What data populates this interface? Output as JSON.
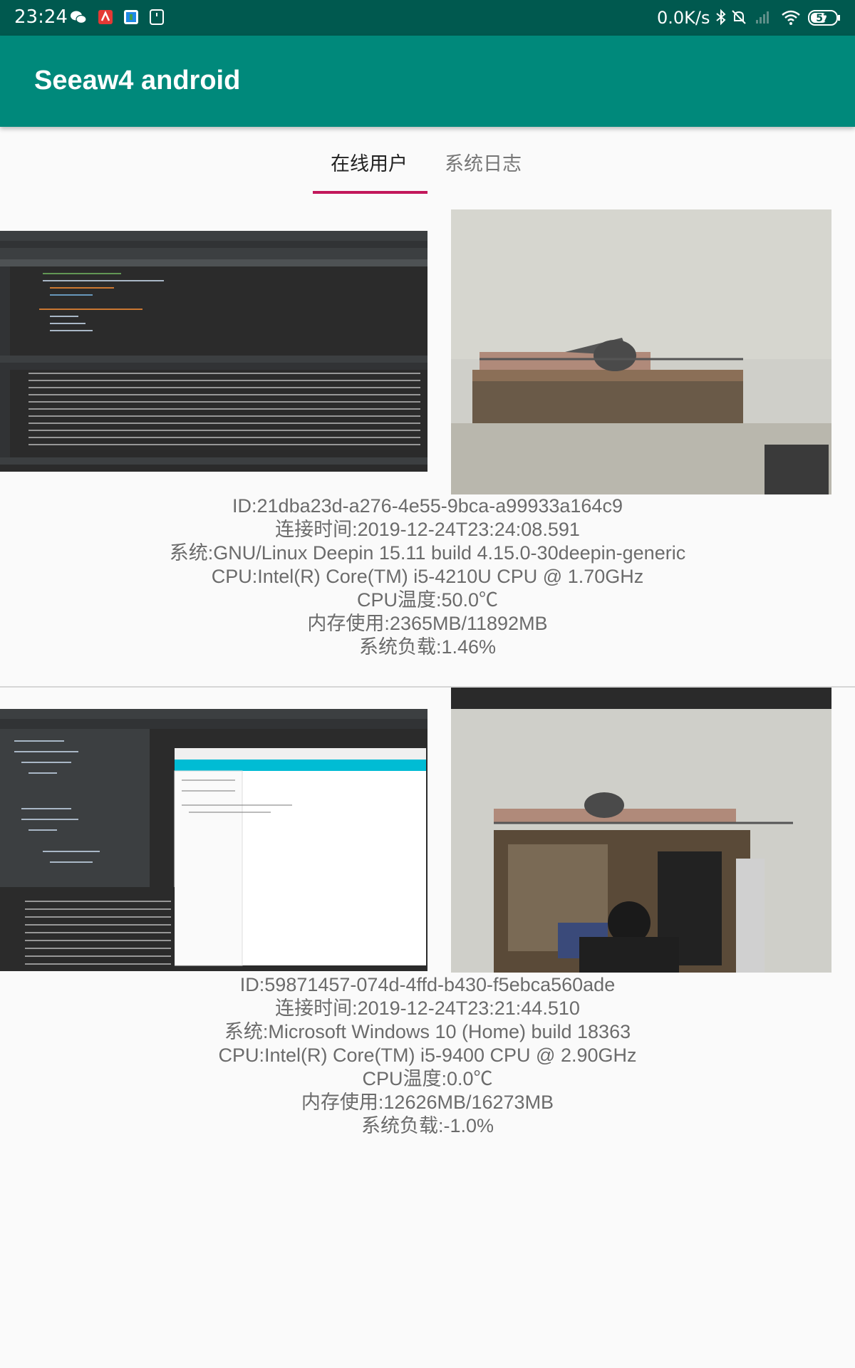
{
  "status_bar": {
    "time": "23:24",
    "network_speed": "0.0K/s",
    "battery": "57"
  },
  "app_bar": {
    "title": "Seeaw4 android"
  },
  "tabs": [
    {
      "label": "在线用户",
      "selected": true
    },
    {
      "label": "系统日志",
      "selected": false
    }
  ],
  "accent_color": "#c2185b",
  "toolbar_color": "#00897b",
  "users": [
    {
      "id": "ID:21dba23d-a276-4e55-9bca-a99933a164c9",
      "connect_time": "连接时间:2019-12-24T23:24:08.591",
      "os": "系统:GNU/Linux Deepin 15.11 build 4.15.0-30deepin-generic",
      "cpu": "CPU:Intel(R) Core(TM) i5-4210U CPU @ 1.70GHz",
      "cpu_temp": "CPU温度:50.0℃",
      "memory": "内存使用:2365MB/11892MB",
      "load": "系统负载:1.46%"
    },
    {
      "id": "ID:59871457-074d-4ffd-b430-f5ebca560ade",
      "connect_time": "连接时间:2019-12-24T23:21:44.510",
      "os": "系统:Microsoft Windows 10 (Home) build 18363",
      "cpu": "CPU:Intel(R) Core(TM) i5-9400 CPU @ 2.90GHz",
      "cpu_temp": "CPU温度:0.0℃",
      "memory": "内存使用:12626MB/16273MB",
      "load": "系统负载:-1.0%"
    }
  ]
}
